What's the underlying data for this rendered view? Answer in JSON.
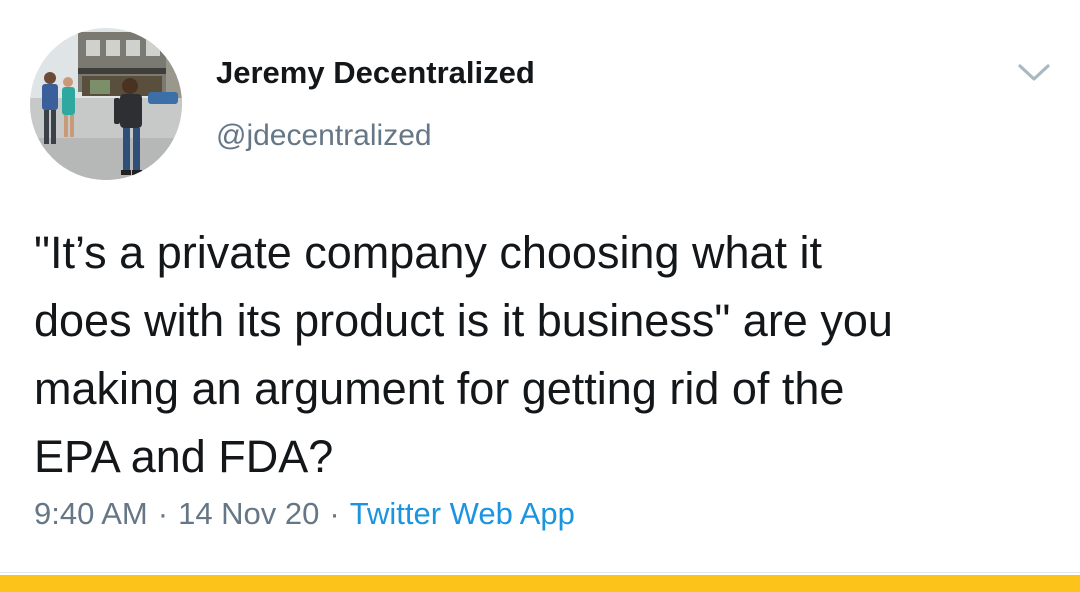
{
  "tweet": {
    "author": {
      "display_name": "Jeremy Decentralized",
      "handle": "@jdecentralized",
      "avatar_icon": "profile-photo-street-scene"
    },
    "menu_icon": "chevron-down-icon",
    "text": "\"It’s a private company choosing what it\ndoes with its product is it business\" are you\nmaking an argument for getting rid of the\nEPA and FDA?",
    "time": "9:40 AM",
    "date": "14 Nov 20",
    "separator": "·",
    "source": "Twitter Web App"
  },
  "colors": {
    "text_primary": "#14171a",
    "text_secondary": "#657786",
    "link": "#1b95e0",
    "divider": "#e1e8ed",
    "bottom_bar": "#fcc41a"
  }
}
